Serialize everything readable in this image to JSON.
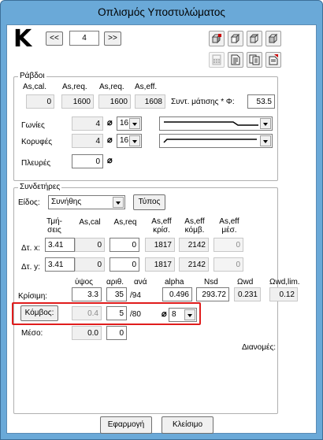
{
  "window": {
    "title": "Οπλισμός Υποστυλώματος"
  },
  "nav": {
    "section_letter": "K",
    "prev_label": "<<",
    "index_value": "4",
    "next_label": ">>"
  },
  "rebars": {
    "title": "Ράβδοι",
    "headers": [
      "As,cal.",
      "As,req.",
      "As,req.",
      "As,eff."
    ],
    "values": [
      "0",
      "1600",
      "1600",
      "1608"
    ],
    "ratio_label": "Συντ. μάτισης * Φ:",
    "ratio_value": "53.5",
    "rows": [
      {
        "label": "Γωνίες",
        "count": "4",
        "diameter": "16"
      },
      {
        "label": "Κορυφές",
        "count": "4",
        "diameter": "16"
      },
      {
        "label": "Πλευρές",
        "count": "0",
        "diameter": ""
      }
    ]
  },
  "stirrups": {
    "title": "Συνδετήρες",
    "type_label": "Είδος:",
    "type_value": "Συνήθης",
    "type_button": "Τύπος",
    "col_headers": [
      "Τμή-\nσεις",
      "As,cal",
      "As,req",
      "As,eff\nκρίσ.",
      "As,eff\nκόμβ.",
      "As,eff\nμέσ."
    ],
    "rows": [
      {
        "label": "Δτ. x:",
        "sections": "3.41",
        "as_cal": "0",
        "as_req": "0",
        "as_eff_kris": "1817",
        "as_eff_komv": "2142",
        "as_eff_mes": "0"
      },
      {
        "label": "Δτ. y:",
        "sections": "3.41",
        "as_cal": "0",
        "as_req": "0",
        "as_eff_kris": "1817",
        "as_eff_komv": "2142",
        "as_eff_mes": "0"
      }
    ],
    "crit_headers": [
      "ύψος",
      "αριθ.",
      "ανά",
      "alpha",
      "Nsd",
      "Ωwd",
      "Ωwd,lim."
    ],
    "critical": {
      "label": "Κρίσιμη:",
      "height": "3.3",
      "count": "35",
      "spacing": "/94",
      "alpha": "0.496",
      "nsd": "293.72",
      "owd": "0.231",
      "owd_lim": "0.12"
    },
    "node": {
      "label": "Κόμβος:",
      "height": "0.4",
      "count": "5",
      "spacing": "/80",
      "diameter": "8"
    },
    "middle": {
      "label": "Μέσο:",
      "height": "0.0",
      "count": "0"
    },
    "spacing_label": "Διανομές:"
  },
  "footer": {
    "apply_label": "Εφαρμογή",
    "close_label": "Κλείσιμο"
  },
  "colors": {
    "titlebar": "#6aa9d8",
    "highlight": "#e01c1c"
  }
}
